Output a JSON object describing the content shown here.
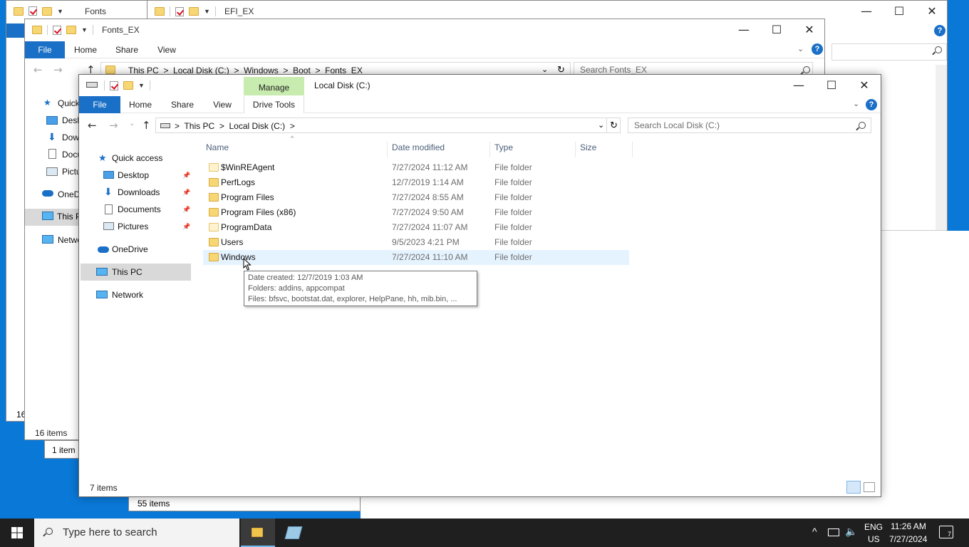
{
  "back_window_fonts": {
    "title": "Fonts",
    "status": "16"
  },
  "back_window_efi": {
    "title": "EFI_EX",
    "status": "55 items"
  },
  "mid_window": {
    "title": "Fonts_EX",
    "tabs": [
      "File",
      "Home",
      "Share",
      "View"
    ],
    "path": [
      "This PC",
      "Local Disk (C:)",
      "Windows",
      "Boot",
      "Fonts_EX"
    ],
    "search_placeholder": "Search Fonts_EX",
    "nav": [
      "Quick",
      "Desk",
      "Dow",
      "Docu",
      "Pictu",
      "OneDr",
      "This P",
      "Netwo"
    ],
    "status": "16 items",
    "status2": "1 item"
  },
  "front_window": {
    "title": "Local Disk (C:)",
    "manage_label": "Manage",
    "tabs": [
      "File",
      "Home",
      "Share",
      "View",
      "Drive Tools"
    ],
    "path": [
      "This PC",
      "Local Disk (C:)"
    ],
    "search_placeholder": "Search Local Disk (C:)",
    "nav": {
      "quick_access": "Quick access",
      "desktop": "Desktop",
      "downloads": "Downloads",
      "documents": "Documents",
      "pictures": "Pictures",
      "onedrive": "OneDrive",
      "this_pc": "This PC",
      "network": "Network"
    },
    "columns": [
      "Name",
      "Date modified",
      "Type",
      "Size"
    ],
    "rows": [
      {
        "name": "$WinREAgent",
        "date": "7/27/2024 11:12 AM",
        "type": "File folder"
      },
      {
        "name": "PerfLogs",
        "date": "12/7/2019 1:14 AM",
        "type": "File folder"
      },
      {
        "name": "Program Files",
        "date": "7/27/2024 8:55 AM",
        "type": "File folder"
      },
      {
        "name": "Program Files (x86)",
        "date": "7/27/2024 9:50 AM",
        "type": "File folder"
      },
      {
        "name": "ProgramData",
        "date": "7/27/2024 11:07 AM",
        "type": "File folder"
      },
      {
        "name": "Users",
        "date": "9/5/2023 4:21 PM",
        "type": "File folder"
      },
      {
        "name": "Windows",
        "date": "7/27/2024 11:10 AM",
        "type": "File folder"
      }
    ],
    "tooltip": {
      "line1": "Date created: 12/7/2019 1:03 AM",
      "line2": "Folders: addins, appcompat",
      "line3": "Files: bfsvc, bootstat.dat, explorer, HelpPane, hh, mib.bin, ..."
    },
    "status": "7 items"
  },
  "taskbar": {
    "search_placeholder": "Type here to search",
    "lang_top": "ENG",
    "lang_bottom": "US",
    "time": "11:26 AM",
    "date": "7/27/2024",
    "notifications": "7"
  },
  "colors": {
    "accent": "#1a6fc7",
    "desktop": "#0a78d7",
    "manage_tab": "#c8ebb0",
    "selected": "#e5f3ff"
  }
}
